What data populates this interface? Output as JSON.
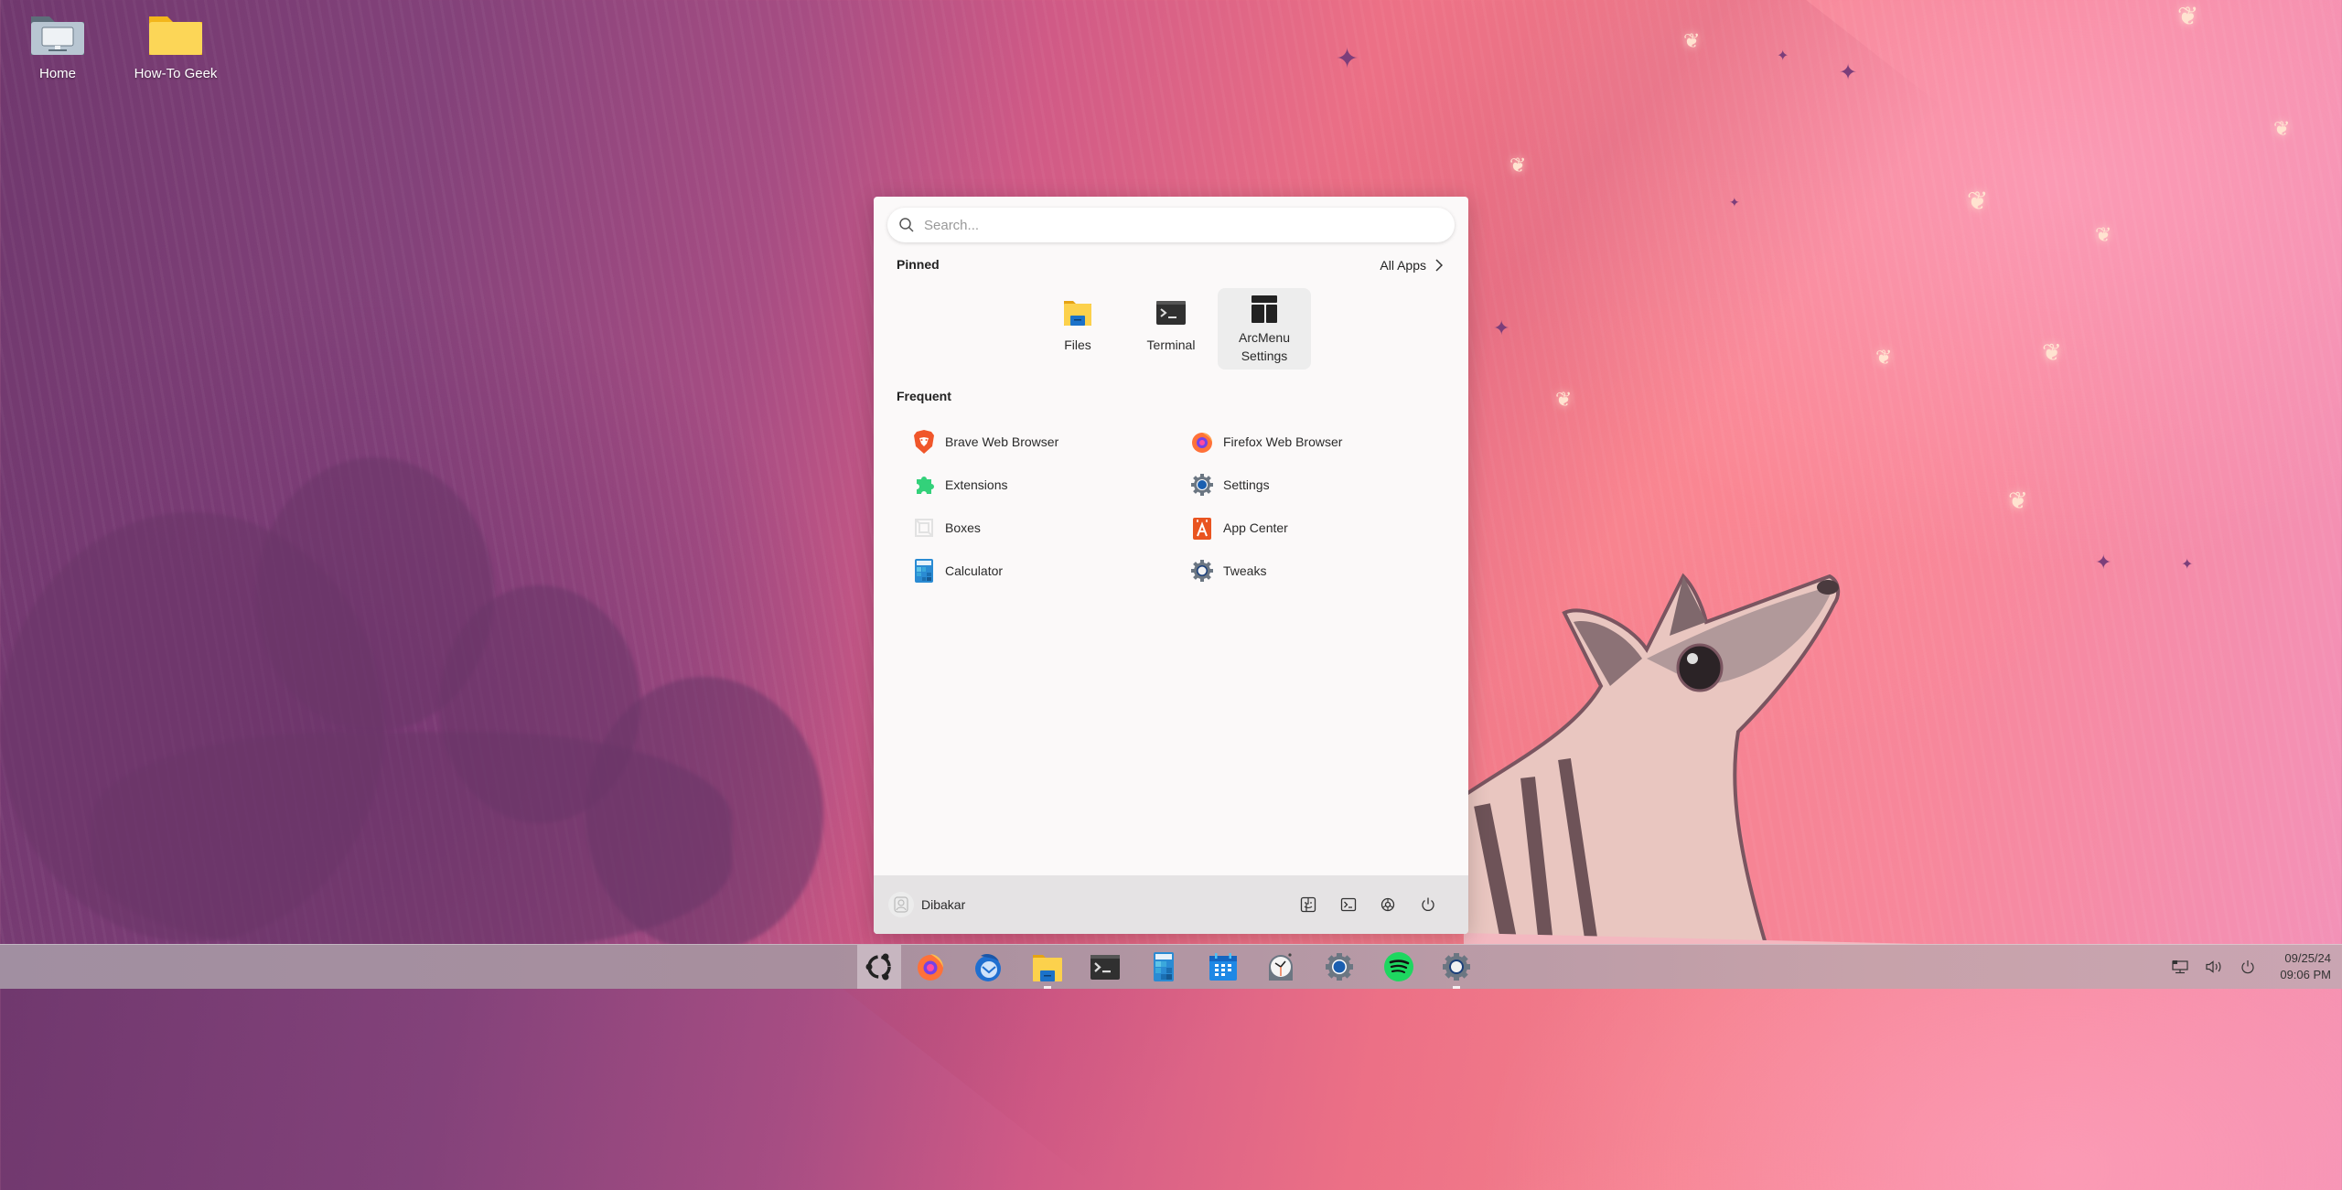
{
  "desktop": {
    "icons": [
      {
        "label": "Home",
        "icon": "home-folder-icon"
      },
      {
        "label": "How-To Geek",
        "icon": "folder-icon"
      }
    ]
  },
  "menu": {
    "search": {
      "placeholder": "Search...",
      "value": ""
    },
    "pinned": {
      "title": "Pinned",
      "all_apps_label": "All Apps",
      "items": [
        {
          "label": "Files",
          "icon": "files-icon"
        },
        {
          "label": "Terminal",
          "icon": "terminal-icon"
        },
        {
          "label": "ArcMenu Settings",
          "line1": "ArcMenu",
          "line2": "Settings",
          "icon": "arcmenu-settings-icon",
          "active": true
        }
      ]
    },
    "frequent": {
      "title": "Frequent",
      "items": [
        {
          "label": "Brave Web Browser",
          "icon": "brave-icon"
        },
        {
          "label": "Firefox Web Browser",
          "icon": "firefox-icon"
        },
        {
          "label": "Extensions",
          "icon": "extensions-icon"
        },
        {
          "label": "Settings",
          "icon": "settings-icon"
        },
        {
          "label": "Boxes",
          "icon": "boxes-icon"
        },
        {
          "label": "App Center",
          "icon": "app-center-icon"
        },
        {
          "label": "Calculator",
          "icon": "calculator-icon"
        },
        {
          "label": "Tweaks",
          "icon": "tweaks-icon"
        }
      ]
    },
    "footer": {
      "user_name": "Dibakar",
      "buttons": [
        {
          "name": "home-folder",
          "icon": "finder-face-icon"
        },
        {
          "name": "terminal",
          "icon": "terminal-prompt-icon"
        },
        {
          "name": "settings",
          "icon": "gear-icon"
        },
        {
          "name": "power",
          "icon": "power-icon"
        }
      ]
    }
  },
  "taskbar": {
    "apps": [
      {
        "name": "activities",
        "icon": "ubuntu-logo-icon",
        "active": true
      },
      {
        "name": "firefox",
        "icon": "firefox-icon"
      },
      {
        "name": "thunderbird",
        "icon": "thunderbird-icon"
      },
      {
        "name": "files",
        "icon": "files-icon",
        "running": true
      },
      {
        "name": "terminal",
        "icon": "terminal-icon"
      },
      {
        "name": "calculator",
        "icon": "calculator-icon"
      },
      {
        "name": "calendar",
        "icon": "calendar-icon"
      },
      {
        "name": "clocks",
        "icon": "clock-icon"
      },
      {
        "name": "settings",
        "icon": "settings-icon"
      },
      {
        "name": "spotify",
        "icon": "spotify-icon"
      },
      {
        "name": "tweaks",
        "icon": "tweaks-icon",
        "running": true
      }
    ],
    "tray": [
      {
        "name": "network",
        "icon": "network-wired-icon"
      },
      {
        "name": "volume",
        "icon": "volume-icon"
      },
      {
        "name": "power",
        "icon": "power-icon"
      }
    ],
    "clock": {
      "date": "09/25/24",
      "time": "09:06 PM"
    }
  },
  "colors": {
    "menu_bg": "#fbf9f9",
    "menu_footer_bg": "#e5e3e4",
    "pinned_active_bg": "#ededed",
    "accent_blue": "#1b5fb0"
  }
}
